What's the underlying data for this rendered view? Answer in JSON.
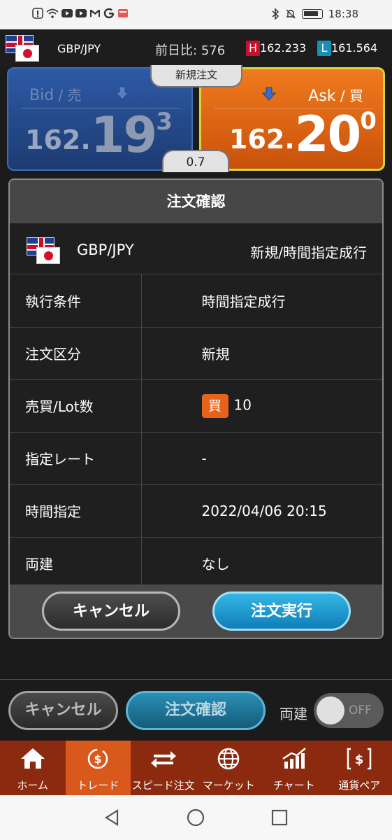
{
  "status_bar": {
    "time": "18:38"
  },
  "header": {
    "pair": "GBP/JPY",
    "change_label": "前日比:",
    "change_value": "576",
    "high_badge": "H",
    "high_value": "162.233",
    "low_badge": "L",
    "low_value": "161.564"
  },
  "bid": {
    "label": "Bid",
    "label_sep": " / ",
    "label_jp": "売",
    "price_small": "162.",
    "price_large": "19",
    "price_sup": "3"
  },
  "ask": {
    "label": "Ask",
    "label_sep": " / ",
    "label_jp": "買",
    "price_small": "162.",
    "price_large": "20",
    "price_sup": "0"
  },
  "new_order_tab": "新規注文",
  "spread": "0.7",
  "dialog": {
    "title": "注文確認",
    "pair": "GBP/JPY",
    "order_type": "新規/時間指定成行",
    "rows": [
      {
        "key": "執行条件",
        "value": "時間指定成行"
      },
      {
        "key": "注文区分",
        "value": "新規"
      },
      {
        "key": "売買/Lot数",
        "badge": "買",
        "value": "10"
      },
      {
        "key": "指定レート",
        "value": "-"
      },
      {
        "key": "時間指定",
        "value": "2022/04/06 20:15"
      },
      {
        "key": "両建",
        "value": "なし"
      }
    ],
    "cancel_label": "キャンセル",
    "execute_label": "注文実行"
  },
  "action_bar": {
    "cancel_label": "キャンセル",
    "confirm_label": "注文確認",
    "hedge_label": "両建",
    "toggle_label": "OFF"
  },
  "tabs": [
    {
      "label": "ホーム",
      "icon": "home-icon"
    },
    {
      "label": "トレード",
      "icon": "trade-icon"
    },
    {
      "label": "スピード注文",
      "icon": "speed-order-icon"
    },
    {
      "label": "マーケット",
      "icon": "globe-icon"
    },
    {
      "label": "チャート",
      "icon": "chart-icon"
    },
    {
      "label": "通貨ペア",
      "icon": "currency-pair-icon"
    }
  ],
  "colors": {
    "bid_blue": "#2d5aa6",
    "ask_orange": "#f07a1e",
    "tab_bar": "#8b2a0f",
    "tab_active": "#d9581b",
    "execute_blue": "#1a9ccf",
    "high_red": "#c8102e",
    "low_blue": "#1a8fb5"
  }
}
